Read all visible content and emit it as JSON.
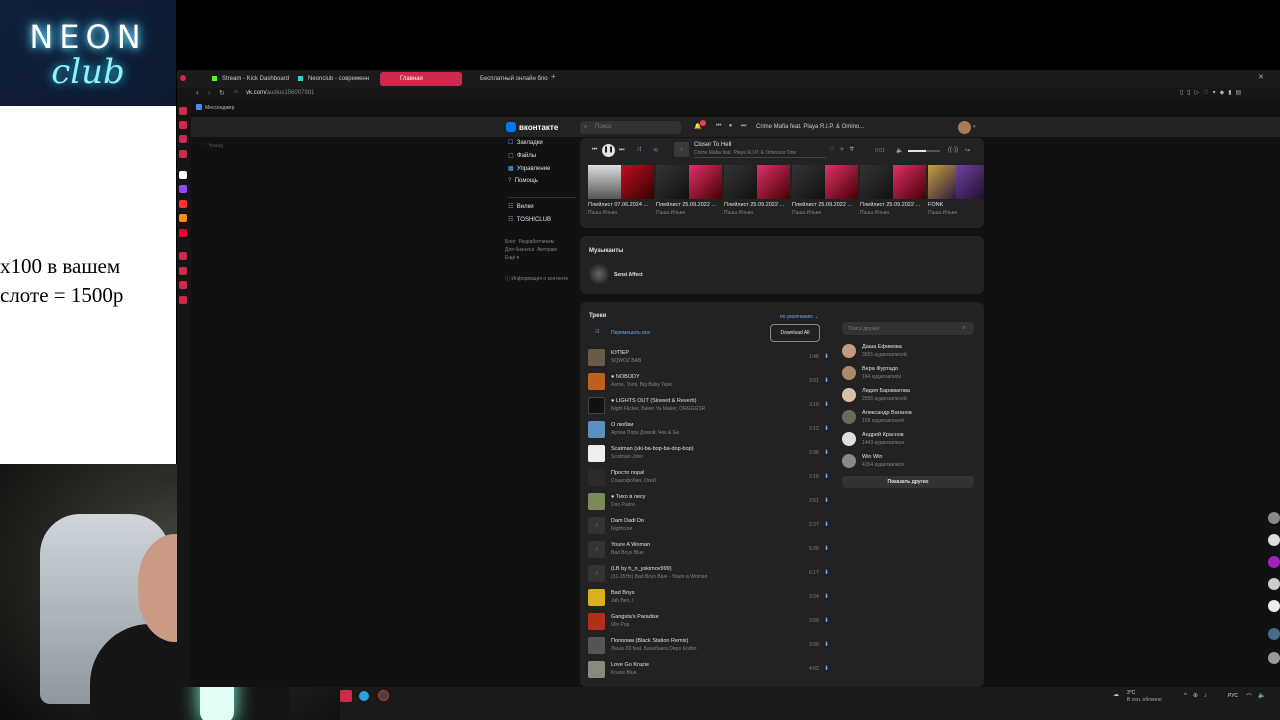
{
  "stream": {
    "logo_top": "NEON",
    "logo_bottom": "club",
    "promo_line1": "x100 в вашем",
    "promo_line2": "слоте = 1500р"
  },
  "browser": {
    "tabs": [
      "Stream - Kick Dashboard",
      "Neonclub - современн",
      "Главная",
      "Бесплатный онлайн блок"
    ],
    "url_prefix": "vk.com/",
    "url_path": "audios156007981",
    "bookmark": "Мессенджер"
  },
  "vk": {
    "logo": "вконтакте",
    "search_placeholder": "Поиск",
    "header_now_playing": "Crime Mafia feat. Playa R.I.P. & Omino...",
    "left_nav": [
      "Закладки",
      "Файлы",
      "Управление",
      "Помощь"
    ],
    "left_nav2": [
      "Вилки",
      "TOSHICLUB"
    ],
    "footer_links": [
      "Блог",
      "Разработчикам",
      "Для бизнеса",
      "Авторам",
      "Ещё"
    ],
    "footer_info": "Информация о контенте",
    "breadcrumb": "Назад",
    "player": {
      "title": "Closer To Hell",
      "artist": "Crime Mafia feat. Playa R.I.P. & Ominous One",
      "time": "0:01"
    },
    "playlists": [
      {
        "title": "Плейлист 07.06.2024 ...",
        "owner": "Паша Ильин"
      },
      {
        "title": "Плейлист 25.09.2022 ...",
        "owner": "Паша Ильин"
      },
      {
        "title": "Плейлист 25.09.2022 ...",
        "owner": "Паша Ильин"
      },
      {
        "title": "Плейлист 25.09.2022 ...",
        "owner": "Паша Ильин"
      },
      {
        "title": "Плейлист 25.09.2022 ...",
        "owner": "Паша Ильин"
      },
      {
        "title": "FONK",
        "owner": "Паша Ильин"
      }
    ],
    "musicians": {
      "heading": "Музыканты",
      "artist": "Sensi Affect"
    },
    "tracks": {
      "heading": "Треки",
      "sort": "по умолчанию",
      "shuffle": "Перемешать все",
      "download": "Download All",
      "items": [
        {
          "title": "КУПЕР",
          "artist": "SQWOZ BAB",
          "dur": "1:46"
        },
        {
          "title": "● NOBODY",
          "artist": "Asme, Tonti, Big Baby Tape",
          "dur": "3:01"
        },
        {
          "title": "● LIGHTS OUT (Slowed & Reverb)",
          "artist": "Night Flicker, Baker Ya Maker, ORGGGSR",
          "dur": "3:10"
        },
        {
          "title": "О любви",
          "artist": "Артем Пора Домой, Чек & Ge",
          "dur": "2:12"
        },
        {
          "title": "Scatman (ski-ba-bop-ba-dop-bop)",
          "artist": "Scatman John",
          "dur": "3:36"
        },
        {
          "title": "Просто пора!",
          "artist": "Социофобия, Owa1",
          "dur": "2:15"
        },
        {
          "title": "● Тихо в лесу",
          "artist": "Don Padre",
          "dur": "2:51"
        },
        {
          "title": "Dam Dadi Do",
          "artist": "Nightcore",
          "dur": "2:27"
        },
        {
          "title": "Youre A Woman",
          "artist": "Bad Boys Blue",
          "dur": "5:25"
        },
        {
          "title": "(LB by h_n_yskimov999)",
          "artist": "(31-35Hz) Bad Boys Blue - Youre a Woman",
          "dur": "6:17"
        },
        {
          "title": "Bad Boys",
          "artist": "Jah Ben, I",
          "dur": "3:24"
        },
        {
          "title": "Gangsta's Paradise",
          "artist": "90s Pop",
          "dur": "3:59"
        },
        {
          "title": "Пополам (Black Station Remix)",
          "artist": "Леша Л3 feat. Бахабанга Depo Kolibri",
          "dur": "3:00"
        },
        {
          "title": "Love Go Krazie",
          "artist": "Krazie Blue",
          "dur": "4:02"
        }
      ]
    },
    "friends": {
      "search_placeholder": "Поиск друзей",
      "show_more": "Показать других",
      "items": [
        {
          "name": "Даша Ефимова",
          "sub": "3655 аудиозаписей"
        },
        {
          "name": "Вера Фуртадо",
          "sub": "164 аудиозаписи"
        },
        {
          "name": "Лидия Барамагова",
          "sub": "2555 аудиозаписей"
        },
        {
          "name": "Александр Ваганов",
          "sub": "158 аудиозаписей"
        },
        {
          "name": "Андрей Краснов",
          "sub": "1443 аудиозаписи"
        },
        {
          "name": "Win Win",
          "sub": "4154 аудиозаписи"
        }
      ]
    }
  },
  "taskbar": {
    "weather_temp": "3°C",
    "weather_desc": "В осн. облачно",
    "lang": "РУС"
  },
  "colors": {
    "accent": "#71aaeb",
    "tab_active": "#cc2b4b",
    "bg": "#141414",
    "card": "#222222"
  }
}
